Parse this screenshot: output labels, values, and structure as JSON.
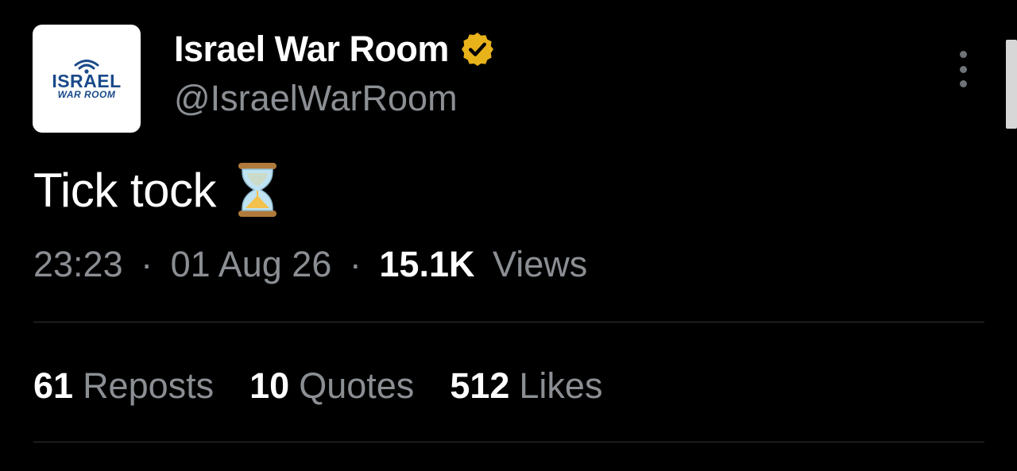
{
  "author": {
    "display_name": "Israel War Room",
    "handle": "@IsraelWarRoom",
    "verified": true,
    "avatar": {
      "line1": "ISRAEL",
      "line2": "WAR ROOM",
      "icon": "wifi-signal-icon"
    }
  },
  "tweet": {
    "text": "Tick tock",
    "emoji": "hourglass-icon"
  },
  "meta": {
    "time": "23:23",
    "sep1": "·",
    "date": "01 Aug 26",
    "sep2": "·",
    "views_count": "15.1K",
    "views_label": "Views"
  },
  "stats": {
    "reposts_count": "61",
    "reposts_label": "Reposts",
    "quotes_count": "10",
    "quotes_label": "Quotes",
    "likes_count": "512",
    "likes_label": "Likes"
  },
  "colors": {
    "background": "#000000",
    "primary_text": "#ffffff",
    "secondary_text": "#8b8f94",
    "divider": "#2f3336",
    "verified_badge": "#e8b21a",
    "brand_blue": "#1a4a8a"
  }
}
